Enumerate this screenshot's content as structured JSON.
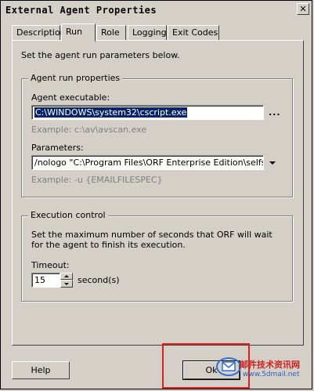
{
  "window": {
    "title": "External Agent Properties",
    "close_label": "✕"
  },
  "tabs": [
    {
      "label": "Description"
    },
    {
      "label": "Run"
    },
    {
      "label": "Role"
    },
    {
      "label": "Logging"
    },
    {
      "label": "Exit Codes"
    }
  ],
  "run_tab": {
    "intro": "Set the agent run parameters below.",
    "agent_group": {
      "legend": "Agent run properties",
      "executable_label": "Agent executable:",
      "executable_value": "C:\\WINDOWS\\system32\\cscript.exe",
      "browse_label": "...",
      "executable_example": "Example: c:\\av\\avscan.exe",
      "parameters_label": "Parameters:",
      "parameters_value": "/nologo \"C:\\Program Files\\ORF Enterprise Edition\\selfspamag",
      "parameters_example": "Example: -u {EMAILFILESPEC}"
    },
    "execution_group": {
      "legend": "Execution control",
      "description": "Set the maximum number of seconds that ORF will wait for the agent to finish its execution.",
      "timeout_label": "Timeout:",
      "timeout_value": "15",
      "timeout_unit": "second(s)"
    }
  },
  "buttons": {
    "help": "Help",
    "ok": "Ok"
  },
  "watermark": {
    "line1": "邮件技术资讯网",
    "line2": "www.5dmail.net"
  },
  "colors": {
    "highlight": "#e02020",
    "selection": "#0a246a"
  }
}
